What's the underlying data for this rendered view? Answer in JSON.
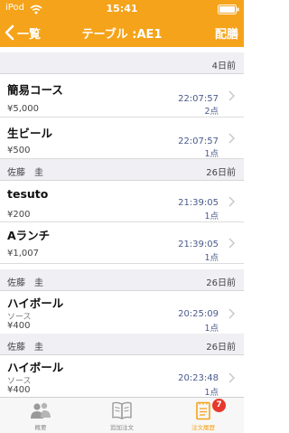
{
  "status_bar": {
    "carrier": "iPod",
    "time": "15:41"
  },
  "nav": {
    "back_label": "一覧",
    "title": "テーブル :AE1",
    "right_label": "配膳"
  },
  "sections": [
    {
      "name": "",
      "count": "4日前",
      "items": [
        {
          "name": "簡易コース",
          "option": "",
          "price": "¥5,000",
          "time": "22:07:57",
          "qty": "2点"
        },
        {
          "name": "生ビール",
          "option": "",
          "price": "¥500",
          "time": "22:07:57",
          "qty": "1点"
        }
      ]
    },
    {
      "name": "佐藤　圭",
      "count": "26日前",
      "items": [
        {
          "name": "tesuto",
          "option": "",
          "price": "¥200",
          "time": "21:39:05",
          "qty": "1点"
        },
        {
          "name": "Aランチ",
          "option": "",
          "price": "¥1,007",
          "time": "21:39:05",
          "qty": "1点"
        }
      ]
    },
    {
      "name": "佐藤　圭",
      "count": "26日前",
      "items": [
        {
          "name": "ハイボール",
          "option": "ソース",
          "price": "¥400",
          "time": "20:25:09",
          "qty": "1点"
        }
      ]
    },
    {
      "name": "佐藤　圭",
      "count": "26日前",
      "items": [
        {
          "name": "ハイボール",
          "option": "ソース",
          "price": "¥400",
          "time": "20:23:48",
          "qty": "1点"
        }
      ]
    }
  ],
  "tabs": [
    {
      "label": "概要",
      "icon": "people-icon"
    },
    {
      "label": "追加注文",
      "icon": "open-book-icon"
    },
    {
      "label": "注文履歴",
      "icon": "order-history-icon",
      "badge": "7",
      "active": true
    }
  ],
  "colors": {
    "accent": "#f5a31a",
    "badge": "#e8372c",
    "time_text": "#4a5a8a"
  }
}
